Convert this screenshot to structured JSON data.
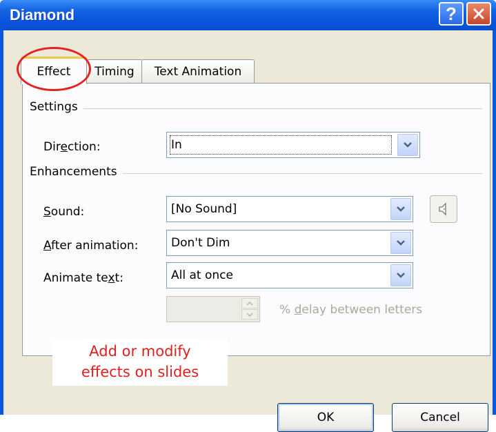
{
  "window": {
    "title": "Diamond"
  },
  "title_buttons": {
    "help_label": "?"
  },
  "tabs": [
    {
      "label": "Effect",
      "active": true
    },
    {
      "label": "Timing",
      "active": false
    },
    {
      "label": "Text Animation",
      "active": false
    }
  ],
  "settings": {
    "heading": "Settings",
    "direction": {
      "label_pre": "Dir",
      "label_mn": "e",
      "label_post": "ction:",
      "value": "In"
    }
  },
  "enhancements": {
    "heading": "Enhancements",
    "sound": {
      "label_mn": "S",
      "label_post": "ound:",
      "value": "[No Sound]"
    },
    "after_animation": {
      "label_mn": "A",
      "label_post": "fter animation:",
      "value": "Don't Dim"
    },
    "animate_text": {
      "label_pre": "Animate te",
      "label_mn": "x",
      "label_post": "t:",
      "value": "All at once"
    },
    "delay": {
      "value": "",
      "label_pre": "% ",
      "label_mn": "d",
      "label_post": "elay between letters"
    }
  },
  "annotation": {
    "line1": "Add or modify",
    "line2": "effects on slides",
    "color": "#e02020"
  },
  "buttons": {
    "ok": "OK",
    "cancel": "Cancel"
  },
  "colors": {
    "title_bar": "#0a55dc",
    "dialog_bg": "#ece9d8",
    "highlight_circle": "#e52222"
  }
}
